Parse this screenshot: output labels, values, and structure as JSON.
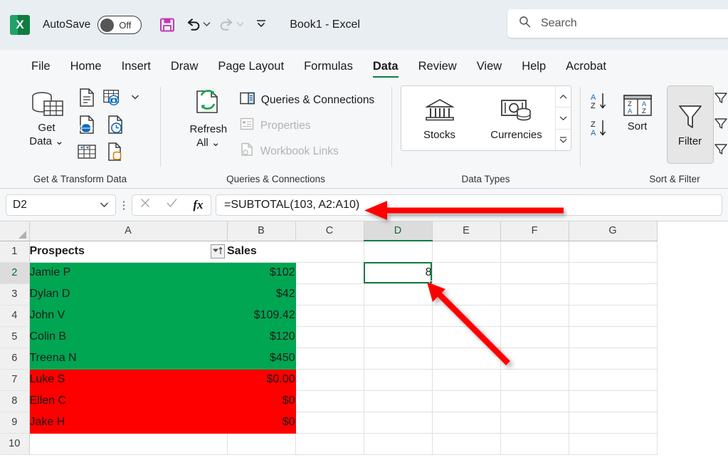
{
  "titlebar": {
    "app_icon": "excel-logo",
    "app_letter": "X",
    "autosave_label": "AutoSave",
    "autosave_state": "Off",
    "save_icon": "save-icon",
    "undo_icon": "undo-icon",
    "redo_icon": "redo-icon",
    "customize_icon": "customize-quick-access-toolbar-icon",
    "document_title": "Book1  -  Excel",
    "search_icon": "search-icon",
    "search_placeholder": "Search"
  },
  "tabs": [
    {
      "label": "File",
      "active": false
    },
    {
      "label": "Home",
      "active": false
    },
    {
      "label": "Insert",
      "active": false
    },
    {
      "label": "Draw",
      "active": false
    },
    {
      "label": "Page Layout",
      "active": false
    },
    {
      "label": "Formulas",
      "active": false
    },
    {
      "label": "Data",
      "active": true
    },
    {
      "label": "Review",
      "active": false
    },
    {
      "label": "View",
      "active": false
    },
    {
      "label": "Help",
      "active": false
    },
    {
      "label": "Acrobat",
      "active": false
    }
  ],
  "ribbon": {
    "groups": {
      "get_transform": {
        "title": "Get & Transform Data",
        "get_data_label_line1": "Get",
        "get_data_label_line2": "Data",
        "icons": [
          "from-text-csv-icon",
          "from-table-range-icon",
          "from-web-icon",
          "recent-sources-icon",
          "from-picture-icon",
          "existing-connections-icon"
        ]
      },
      "queries": {
        "title": "Queries & Connections",
        "refresh_label_line1": "Refresh",
        "refresh_label_line2": "All",
        "items": [
          {
            "label": "Queries & Connections",
            "icon": "queries-connections-icon",
            "disabled": false
          },
          {
            "label": "Properties",
            "icon": "properties-icon",
            "disabled": true
          },
          {
            "label": "Workbook Links",
            "icon": "workbook-links-icon",
            "disabled": true
          }
        ]
      },
      "data_types": {
        "title": "Data Types",
        "items": [
          {
            "label": "Stocks",
            "icon": "stocks-icon"
          },
          {
            "label": "Currencies",
            "icon": "currencies-icon"
          }
        ],
        "scroll_up_icon": "scroll-up-icon",
        "scroll_down_icon": "scroll-down-icon",
        "more_icon": "more-data-types-icon"
      },
      "sort_filter": {
        "title": "Sort & Filter",
        "sort_az_icon": "sort-ascending-icon",
        "sort_za_icon": "sort-descending-icon",
        "sort_label": "Sort",
        "filter_label": "Filter",
        "filter_active": true,
        "extra_icons": [
          "clear-filter-icon",
          "reapply-filter-icon",
          "advanced-filter-icon"
        ]
      }
    }
  },
  "formula_bar": {
    "name_box_value": "D2",
    "name_box_chevron_icon": "chevron-down-icon",
    "more_options_icon": "vertical-ellipsis-icon",
    "cancel_icon": "cancel-icon",
    "enter_icon": "enter-icon",
    "insert_function_icon": "insert-function-icon",
    "formula": "=SUBTOTAL(103, A2:A10)"
  },
  "grid": {
    "column_headers": [
      "A",
      "B",
      "C",
      "D",
      "E",
      "F",
      "G"
    ],
    "selected_column": "D",
    "selected_row": 2,
    "row_numbers": [
      1,
      2,
      3,
      4,
      5,
      6,
      7,
      8,
      9,
      10
    ],
    "filter_dropdown_icon": "filter-sorted-ascending-icon",
    "selected_cell": {
      "ref": "D2",
      "value": "8"
    },
    "rows": [
      {
        "n": 1,
        "a": "Prospects",
        "b": "Sales",
        "fill": "none",
        "header": true
      },
      {
        "n": 2,
        "a": "Jamie P",
        "b": "$102",
        "fill": "green"
      },
      {
        "n": 3,
        "a": "Dylan D",
        "b": "$42",
        "fill": "green"
      },
      {
        "n": 4,
        "a": "John V",
        "b": "$109.42",
        "fill": "green"
      },
      {
        "n": 5,
        "a": "Colin B",
        "b": "$120",
        "fill": "green"
      },
      {
        "n": 6,
        "a": "Treena N",
        "b": "$450",
        "fill": "green"
      },
      {
        "n": 7,
        "a": "Luke S",
        "b": "$0.00",
        "fill": "red"
      },
      {
        "n": 8,
        "a": "Ellen C",
        "b": "$0",
        "fill": "red"
      },
      {
        "n": 9,
        "a": "Jake H",
        "b": "$0",
        "fill": "red"
      },
      {
        "n": 10,
        "a": "",
        "b": "",
        "fill": "none"
      }
    ]
  },
  "colors": {
    "green_fill": "#00A651",
    "red_fill": "#FF0000",
    "excel_accent": "#107C41",
    "annotation_red": "#FF0000"
  },
  "annotations": [
    {
      "name": "arrow-to-formula-bar",
      "target": "formula_bar"
    },
    {
      "name": "arrow-to-cell-d2",
      "target": "cell_d2"
    }
  ]
}
